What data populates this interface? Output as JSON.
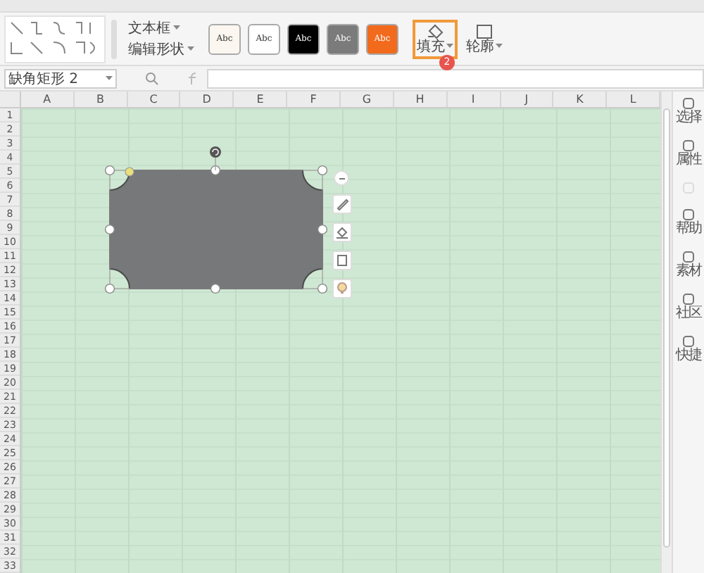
{
  "ribbon": {
    "text_box": "文本框",
    "edit_shape": "编辑形状",
    "style_swatches": [
      {
        "label": "Abc",
        "color": "#fbf7f0"
      },
      {
        "label": "Abc",
        "color": "#ffffff"
      },
      {
        "label": "Abc",
        "color": "#000000"
      },
      {
        "label": "Abc",
        "color": "#7b7b7b"
      },
      {
        "label": "Abc",
        "color": "#f26a1b"
      }
    ],
    "fill_button": {
      "label": "填充",
      "highlighted": true,
      "badge": "2"
    },
    "outline_button": {
      "label": "轮廓"
    }
  },
  "formula_bar": {
    "name_box": "缺角矩形 2"
  },
  "columns": [
    "A",
    "B",
    "C",
    "D",
    "E",
    "F",
    "G",
    "H",
    "I",
    "J",
    "K",
    "L"
  ],
  "rows": [
    "1",
    "2",
    "3",
    "4",
    "5",
    "6",
    "7",
    "8",
    "9",
    "10",
    "11",
    "12",
    "13",
    "14",
    "15",
    "16",
    "17",
    "18",
    "19",
    "20",
    "21",
    "22",
    "23",
    "24",
    "25",
    "26",
    "27",
    "28",
    "29",
    "30",
    "31",
    "32",
    "33"
  ],
  "shape": {
    "selected": true
  },
  "shape_tools": [
    {
      "kind": "minus"
    },
    {
      "kind": "pen"
    },
    {
      "kind": "fill"
    },
    {
      "kind": "outline"
    },
    {
      "kind": "bulb"
    }
  ],
  "sidebar": [
    {
      "label": "选择",
      "disabled": false
    },
    {
      "label": "属性",
      "disabled": false
    },
    {
      "disabled": true
    },
    {
      "label": "帮助",
      "disabled": false
    },
    {
      "label": "素材",
      "disabled": false
    },
    {
      "label": "社区",
      "disabled": false
    },
    {
      "label": "快捷",
      "disabled": false
    }
  ]
}
